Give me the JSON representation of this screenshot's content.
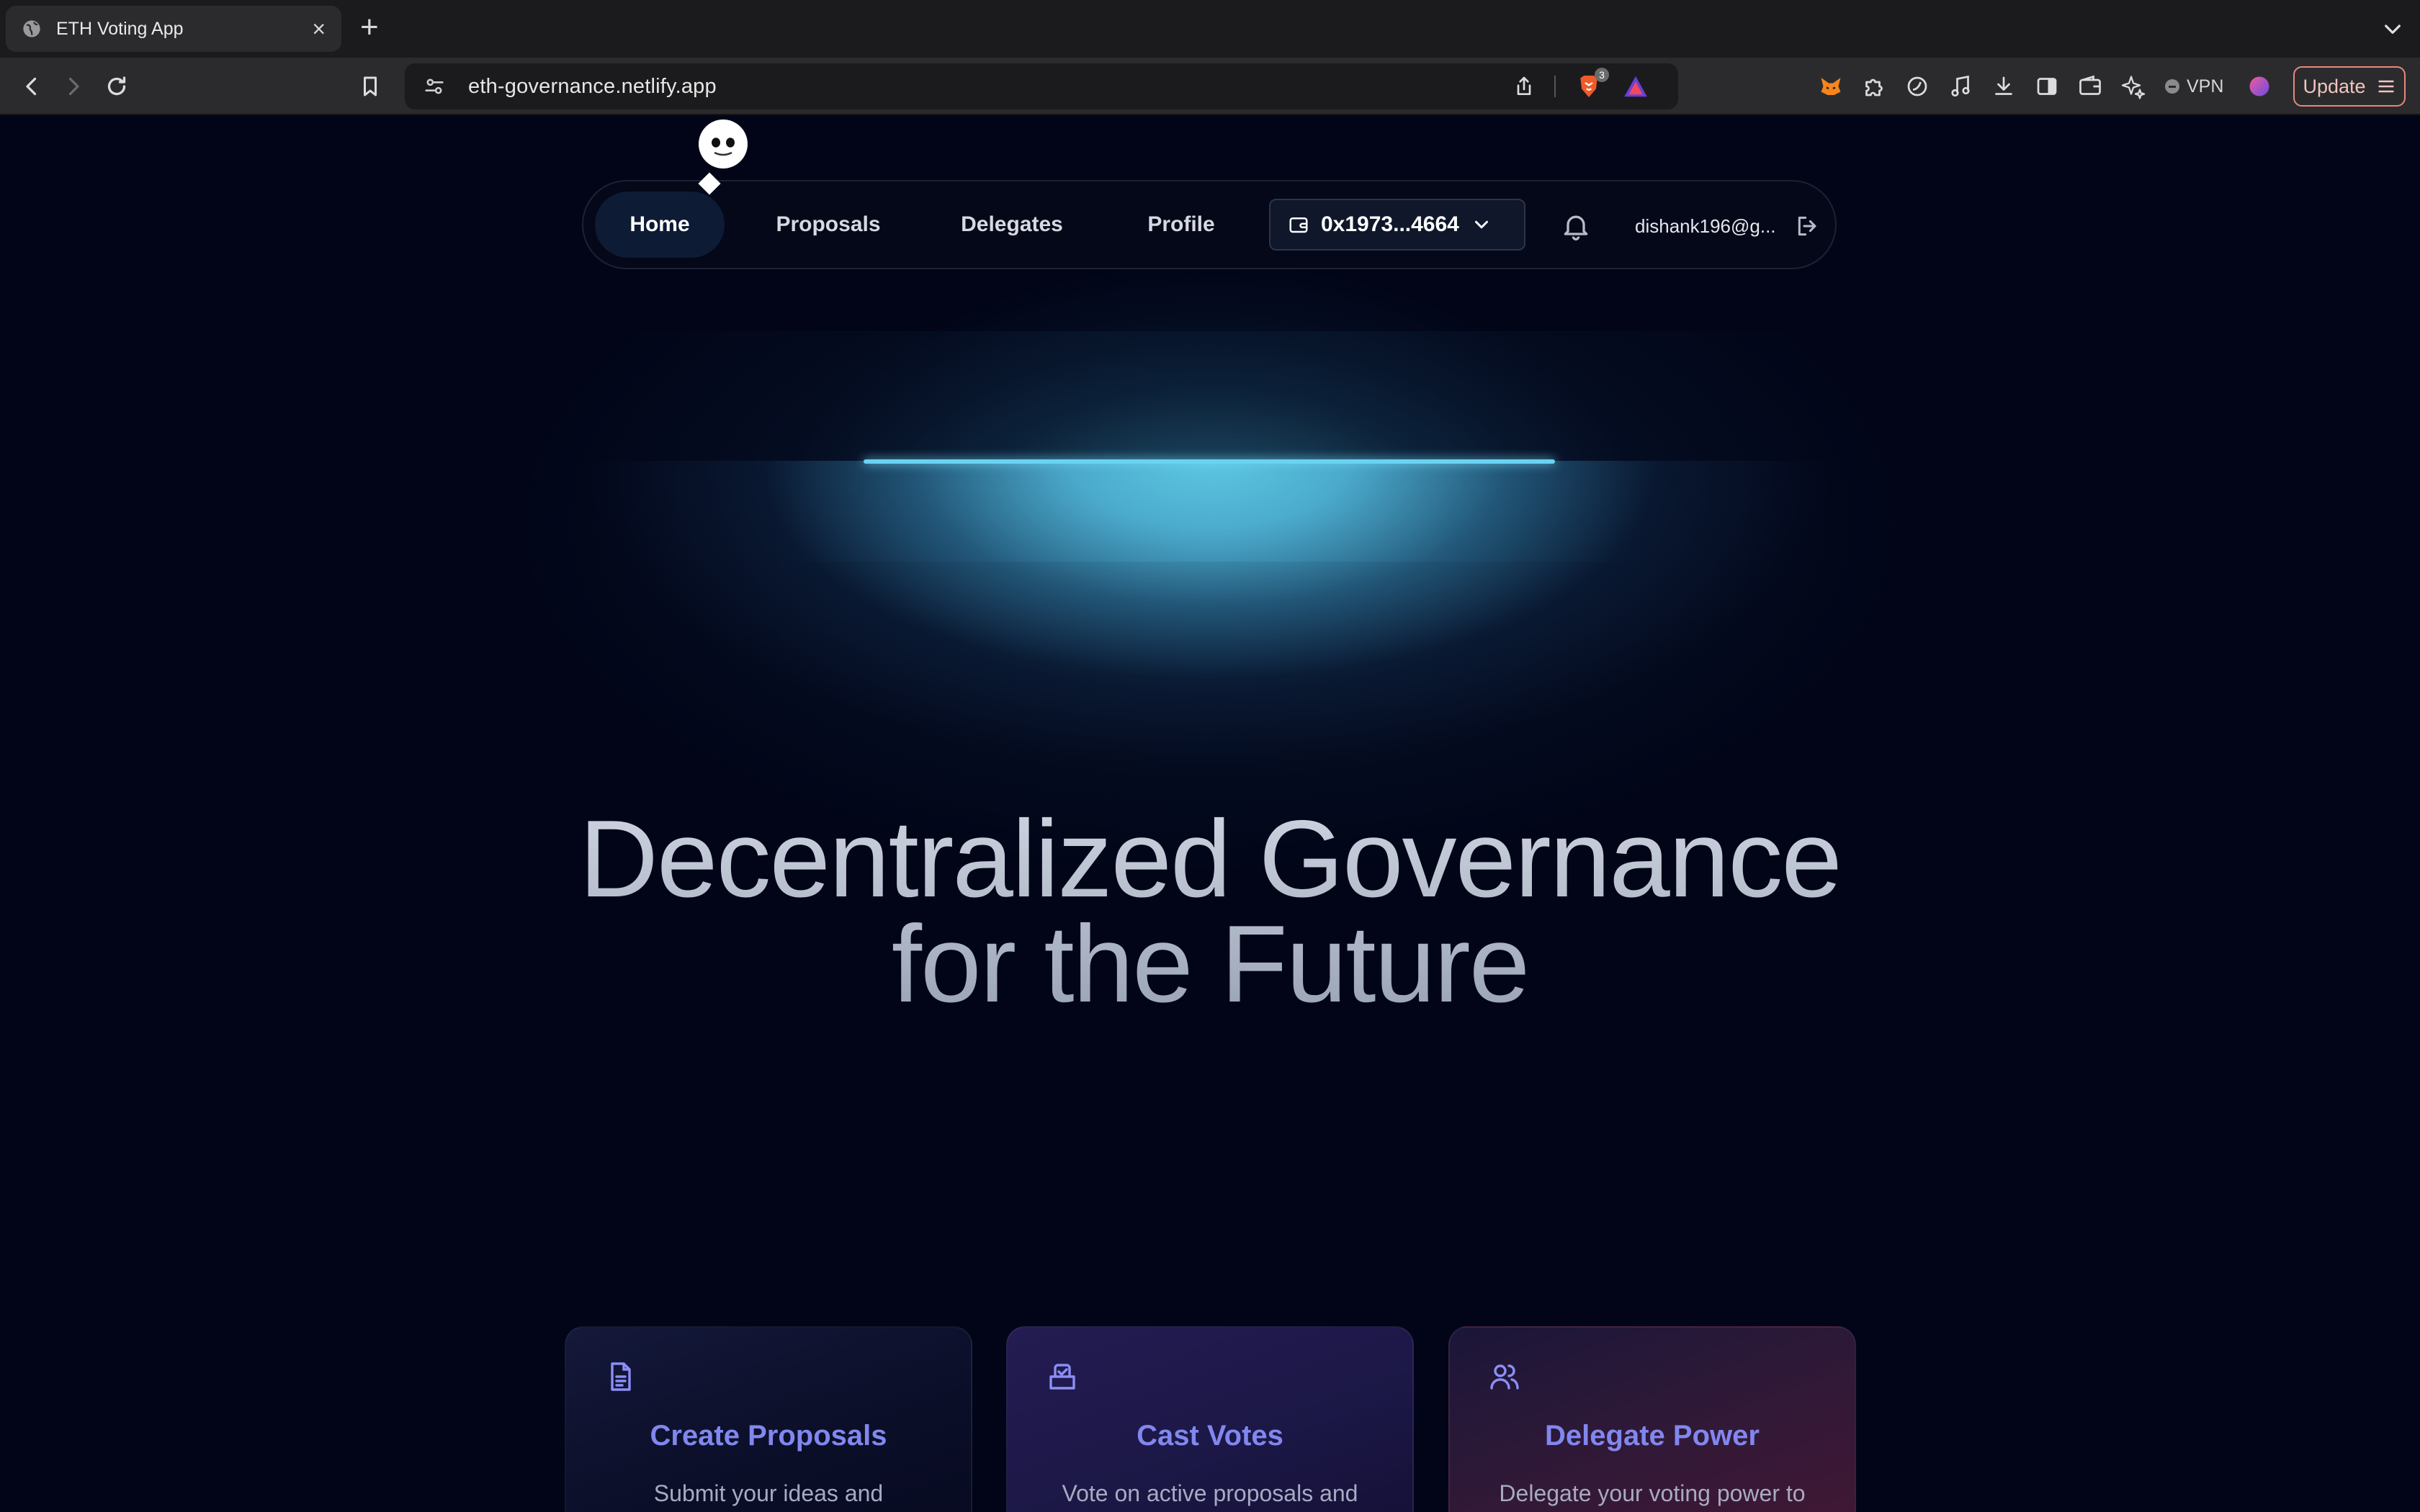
{
  "browser": {
    "tab": {
      "title": "ETH Voting App",
      "close_glyph": "×"
    },
    "new_tab_glyph": "+",
    "url": "eth-governance.netlify.app",
    "shields_count": "3",
    "vpn_label": "VPN",
    "update_label": "Update",
    "accent_color": "#e8877a"
  },
  "navbar": {
    "items": [
      {
        "label": "Home",
        "active": true
      },
      {
        "label": "Proposals"
      },
      {
        "label": "Delegates"
      },
      {
        "label": "Profile"
      }
    ],
    "wallet_address": "0x1973...4664",
    "user_email": "dishank196@g..."
  },
  "hero": {
    "line1": "Decentralized Governance",
    "line2": "for the Future",
    "lamp_color": "#69d3f2"
  },
  "features": [
    {
      "icon": "document-icon",
      "title": "Create Proposals",
      "text": "Submit your ideas and"
    },
    {
      "icon": "vote-box-icon",
      "title": "Cast Votes",
      "text": "Vote on active proposals and"
    },
    {
      "icon": "users-icon",
      "title": "Delegate Power",
      "text": "Delegate your voting power to"
    }
  ]
}
